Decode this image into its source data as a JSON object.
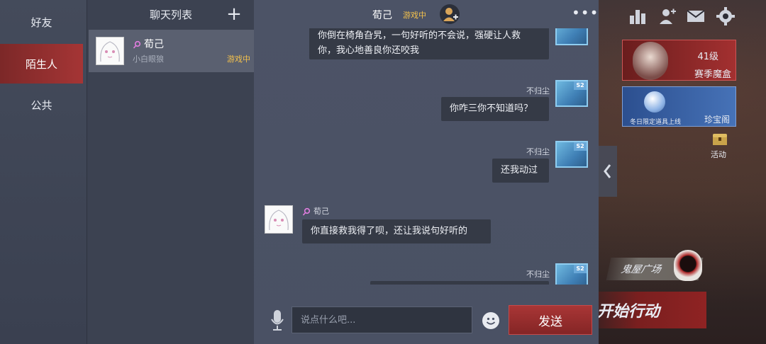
{
  "sidebar": {
    "items": [
      {
        "label": "好友",
        "active": false
      },
      {
        "label": "陌生人",
        "active": true
      },
      {
        "label": "公共",
        "active": false
      }
    ]
  },
  "chat_list": {
    "title": "聊天列表",
    "add_symbol": "+",
    "contacts": [
      {
        "name": "荀己",
        "subtitle": "小白眼狼",
        "status": "游戏中",
        "gender_icon": "female-icon"
      }
    ]
  },
  "chat": {
    "title": "荀己",
    "title_status": "游戏中",
    "more_symbol": "•••",
    "messages": [
      {
        "from": "other",
        "sender": "",
        "text_lines": [
          "你倒在椅角旮旯，一句好听的不会说，强硬让人救",
          "你，我心地善良你还咬我"
        ]
      },
      {
        "from": "self",
        "sender": "不归尘",
        "text_lines": [
          "你咋三你不知道吗？"
        ]
      },
      {
        "from": "self",
        "sender": "不归尘",
        "text_lines": [
          "还我动过"
        ]
      },
      {
        "from": "other",
        "sender": "荀己",
        "text_lines": [
          "你直接救我得了呗，还让我说句好听的"
        ]
      },
      {
        "from": "self",
        "sender": "不归尘",
        "text_lines": [
          ""
        ]
      }
    ],
    "self_badge": "S2"
  },
  "input": {
    "placeholder": "说点什么吧...",
    "value": "",
    "send_label": "发送"
  },
  "game": {
    "level_label": "41级",
    "season_box_label": "赛季魔盒",
    "winter_label": "冬日限定道具上线",
    "treasure_label": "珍宝阁",
    "activity_label": "活动",
    "haunted_label": "鬼屋广场",
    "start_label": "开始行动"
  },
  "colors": {
    "accent_red": "#a53535",
    "status_yellow": "#f3c14c",
    "bubble_bg": "#353a46",
    "panel_bg": "#4c5366"
  }
}
